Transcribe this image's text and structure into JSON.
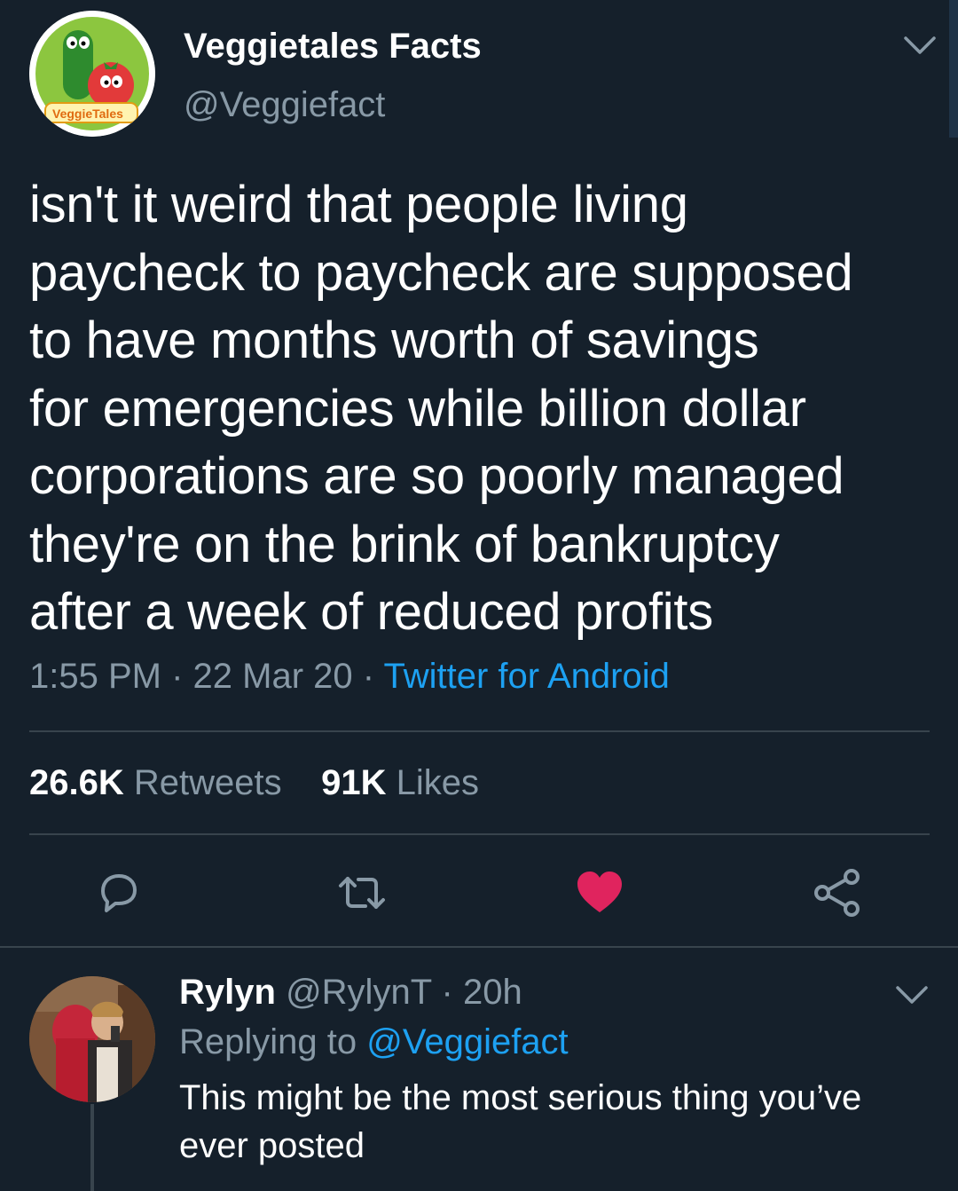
{
  "colors": {
    "background": "#15202b",
    "secondary_text": "#8899a6",
    "link": "#1da1f2",
    "like": "#e0245e",
    "divider": "#38444d"
  },
  "tweet": {
    "display_name": "Veggietales Facts",
    "handle": "@Veggiefact",
    "avatar_logo_text": "VeggieTales",
    "text_lines": [
      "isn't it weird that people living",
      "paycheck to paycheck are supposed",
      "to have months worth of savings",
      "for emergencies while billion dollar",
      "corporations are so poorly managed",
      "they're on the brink of bankruptcy",
      "after a week of reduced profits"
    ],
    "time": "1:55 PM",
    "date": "22 Mar 20",
    "source": "Twitter for Android",
    "separator": "·",
    "retweets_count": "26.6K",
    "retweets_label": "Retweets",
    "likes_count": "91K",
    "likes_label": "Likes",
    "liked": true,
    "icons": [
      "chevron-down-icon",
      "reply-icon",
      "retweet-icon",
      "heart-icon",
      "share-icon"
    ]
  },
  "reply": {
    "display_name": "Rylyn",
    "handle": "@RylynT",
    "separator": "·",
    "time": "20h",
    "replying_to_label": "Replying to",
    "replying_to_handle": "@Veggiefact",
    "text": "This might be the most serious thing you’ve ever posted"
  }
}
